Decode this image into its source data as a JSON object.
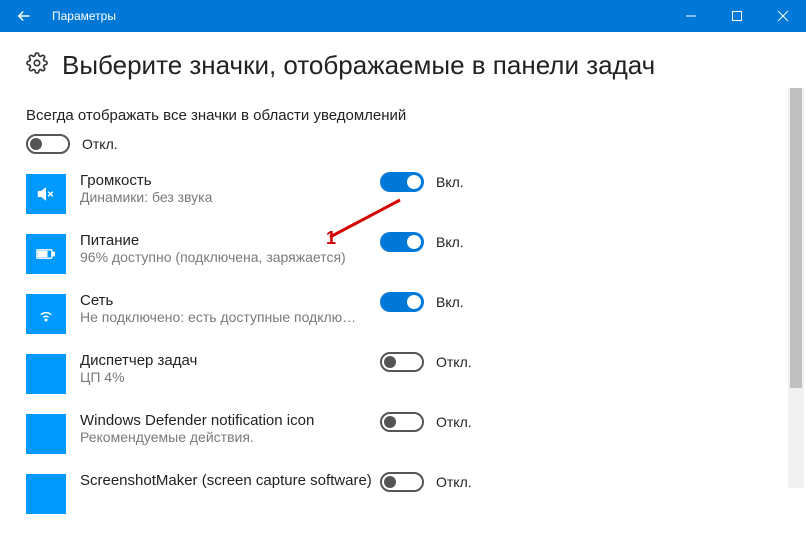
{
  "titlebar": {
    "title": "Параметры"
  },
  "heading": "Выберите значки, отображаемые в панели задач",
  "always": {
    "label": "Всегда отображать все значки в области уведомлений",
    "state_label": "Откл.",
    "on": false
  },
  "on_label": "Вкл.",
  "off_label": "Откл.",
  "items": [
    {
      "title": "Громкость",
      "sub": "Динамики: без звука",
      "on": true,
      "icon": "volume"
    },
    {
      "title": "Питание",
      "sub": "96% доступно (подключена, заряжается)",
      "on": true,
      "icon": "battery"
    },
    {
      "title": "Сеть",
      "sub": "Не подключено: есть доступные подклю…",
      "on": true,
      "icon": "network"
    },
    {
      "title": "Диспетчер задач",
      "sub": "ЦП 4%",
      "on": false,
      "icon": "blank"
    },
    {
      "title": "Windows Defender notification icon",
      "sub": "Рекомендуемые действия.",
      "on": false,
      "icon": "blank"
    },
    {
      "title": "ScreenshotMaker (screen capture software)",
      "sub": "",
      "on": false,
      "icon": "blank"
    }
  ],
  "annotation": {
    "num": "1"
  }
}
